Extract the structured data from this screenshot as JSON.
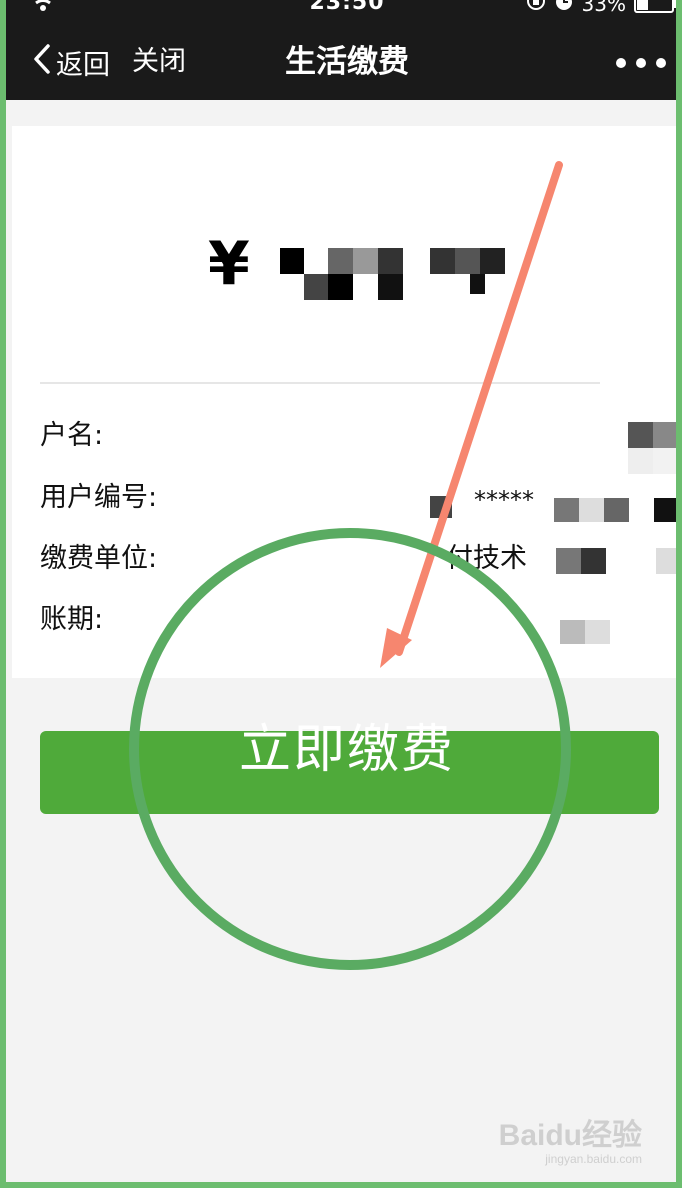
{
  "status": {
    "time": "23:50",
    "battery": "33%"
  },
  "nav": {
    "back_label": "返回",
    "close_label": "关闭",
    "title": "生活缴费"
  },
  "bill": {
    "currency": "¥",
    "fields": [
      {
        "label": "户名:",
        "value": ""
      },
      {
        "label": "用户编号:",
        "value": "*****"
      },
      {
        "label": "缴费单位:",
        "value": "付技术"
      },
      {
        "label": "账期:",
        "value": ""
      }
    ]
  },
  "pay_button": {
    "label": "立即缴费"
  },
  "watermark": {
    "main": "Baidu经验",
    "sub": "jingyan.baidu.com"
  },
  "colors": {
    "topbar": "#1a1a1a",
    "button": "#4faa3a",
    "highlight_circle": "#5aab62",
    "arrow": "#f6866f",
    "frame": "#6cbd6f"
  }
}
